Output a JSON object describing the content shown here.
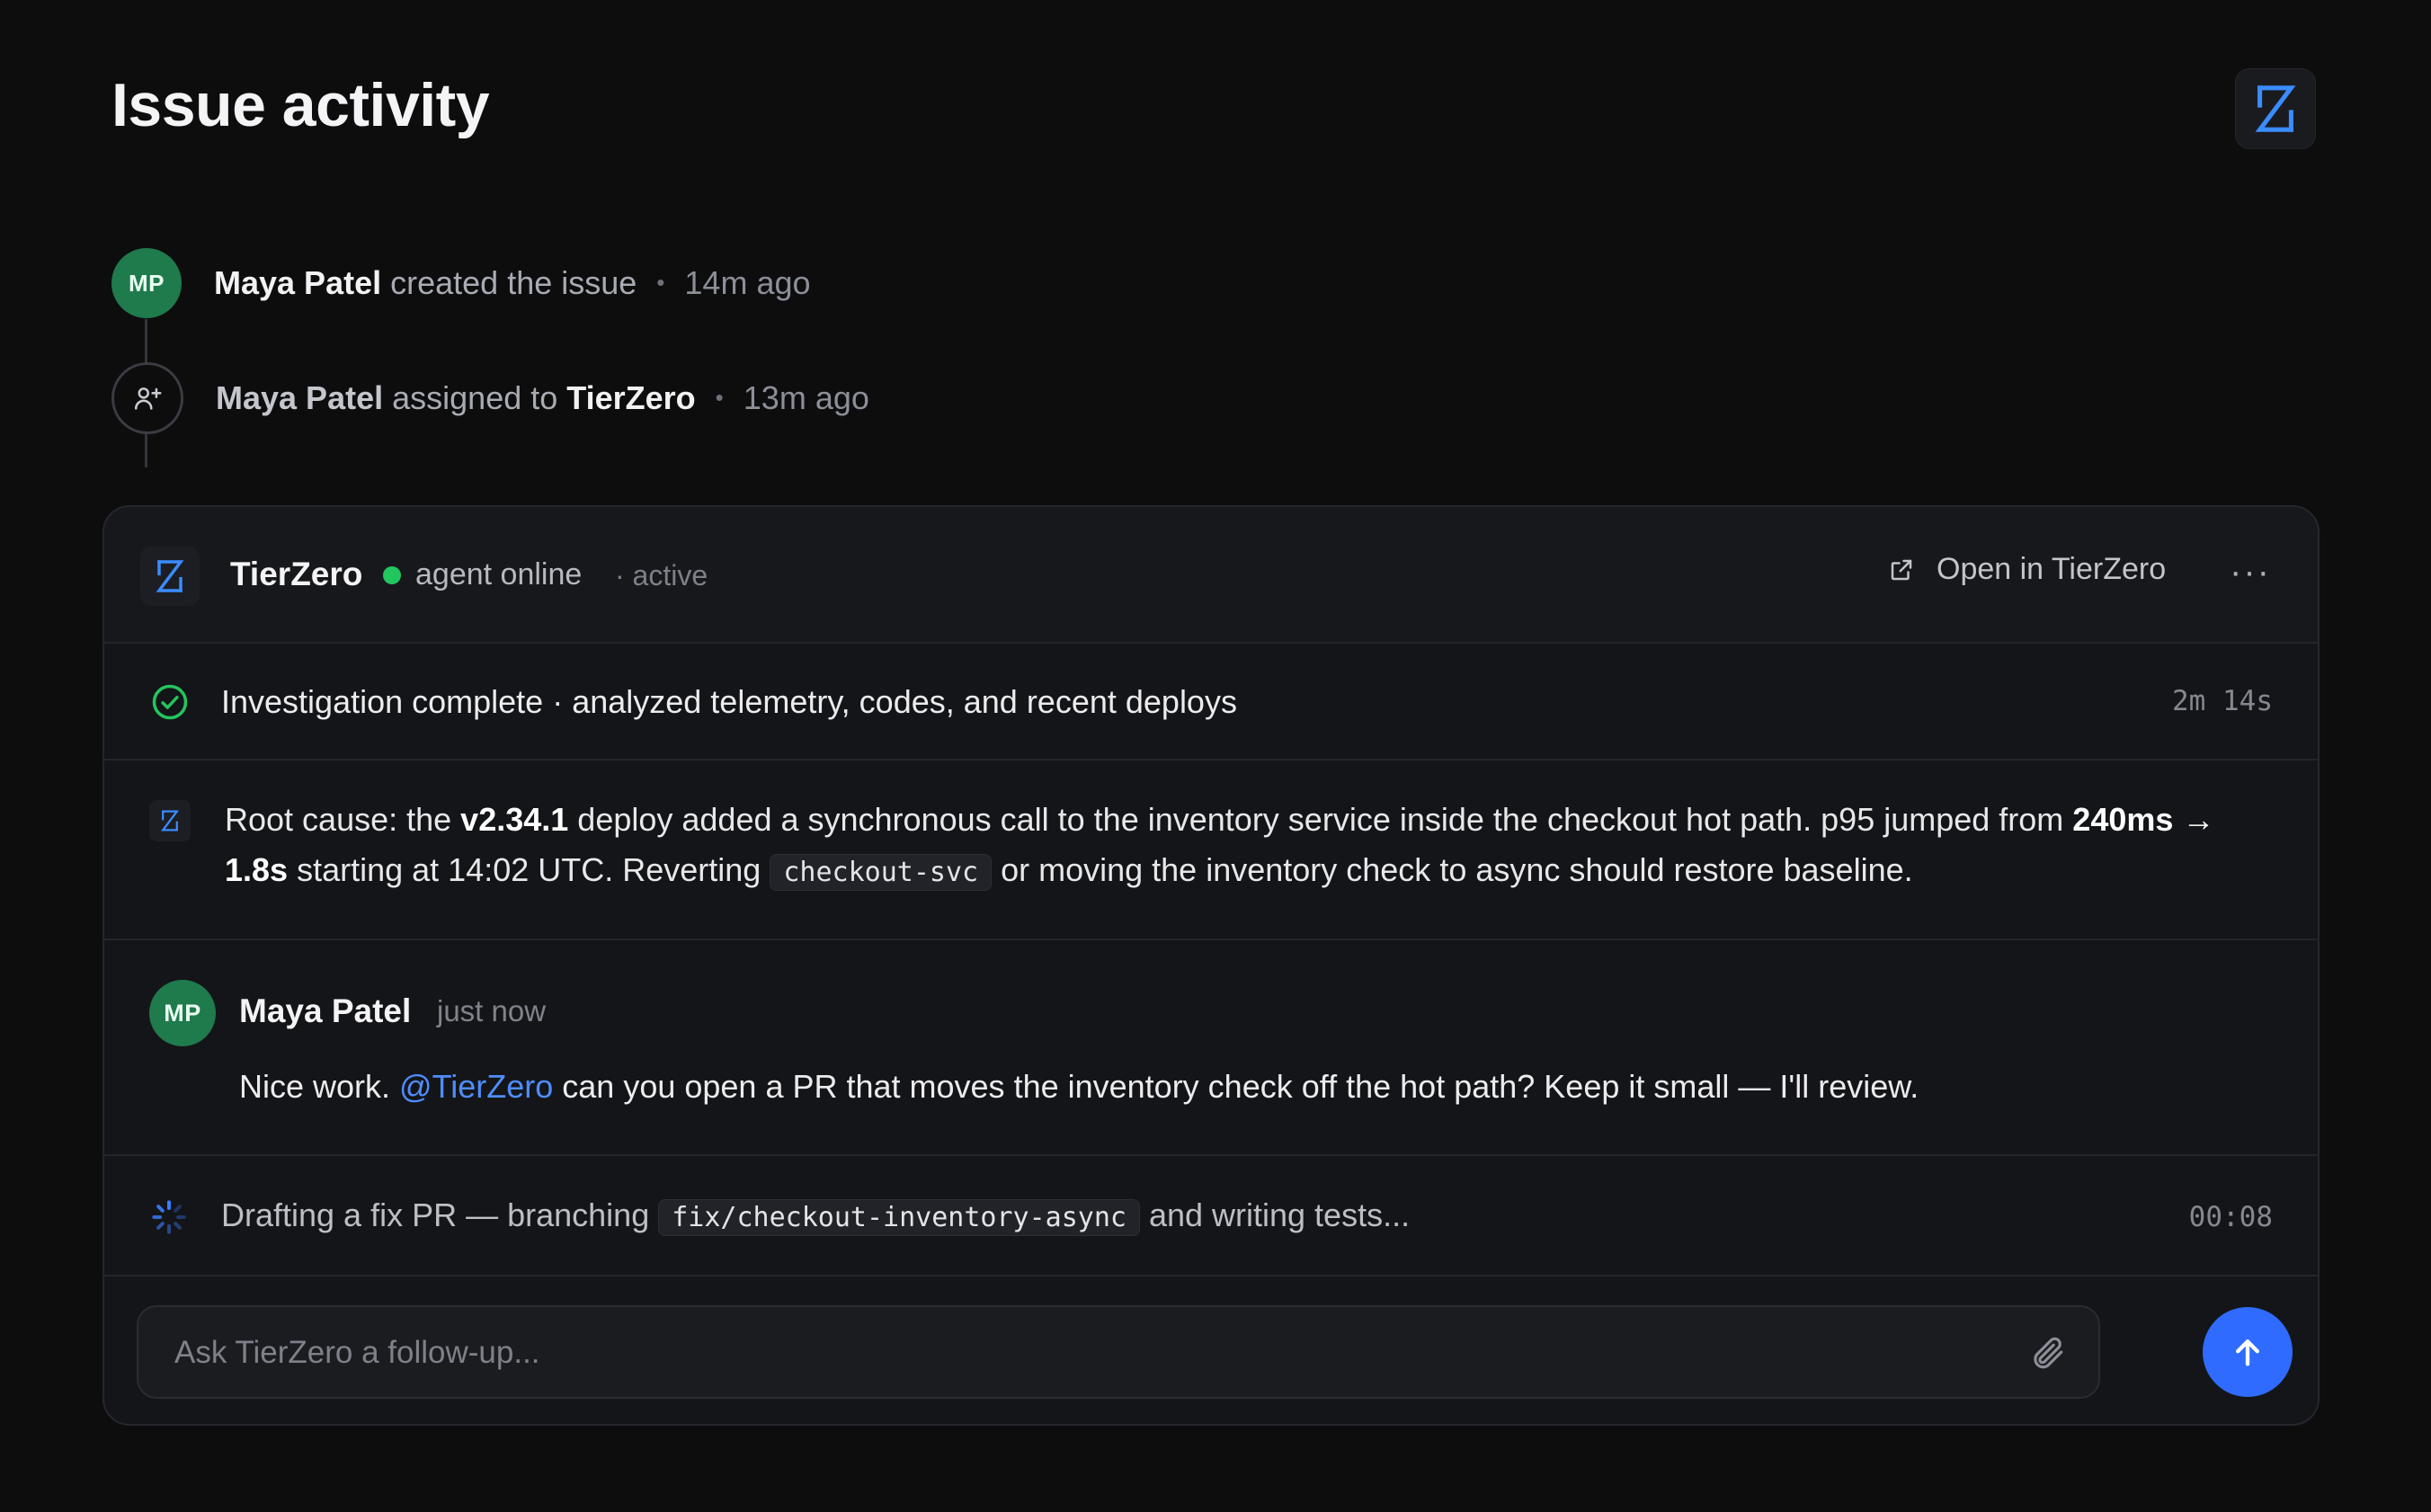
{
  "page": {
    "title": "Issue activity"
  },
  "timeline": [
    {
      "avatar": "MP",
      "actor": "Maya Patel",
      "action": "created the issue",
      "time": "14m ago"
    },
    {
      "icon": "user-plus-icon",
      "actor": "Maya Patel",
      "action": "assigned to",
      "target": "TierZero",
      "time": "13m ago"
    }
  ],
  "agent_card": {
    "name": "TierZero",
    "status": "agent online",
    "state": "· active",
    "open_label": "Open in TierZero",
    "more_label": "···",
    "investigation": {
      "text": "Investigation complete · analyzed telemetry, codes, and recent deploys",
      "duration": "2m 14s"
    },
    "root_cause": {
      "p1": "Root cause: the ",
      "version": "v2.34.1",
      "p2": " deploy added a synchronous call to the inventory service inside the checkout hot path. p95 jumped from ",
      "latency": "240ms → 1.8s",
      "p3": " starting at 14:02 UTC. Reverting ",
      "service": "checkout-svc",
      "p4": " or moving the inventory check to async should restore baseline."
    },
    "comment": {
      "avatar": "MP",
      "author": "Maya Patel",
      "time": "just now",
      "p1": "Nice work. ",
      "mention": "@TierZero",
      "p2": " can you open a PR that moves the inventory check off the hot path? Keep it small — I'll review."
    },
    "drafting": {
      "p1": "Drafting a fix PR — branching ",
      "branch": "fix/checkout-inventory-async",
      "p2": " and writing tests...",
      "elapsed": "00:08"
    },
    "input": {
      "placeholder": "Ask TierZero a follow-up..."
    }
  },
  "colors": {
    "accent": "#2f6bff",
    "online": "#23c55e",
    "avatar": "#1f7a4c",
    "mention": "#4f8dff"
  }
}
